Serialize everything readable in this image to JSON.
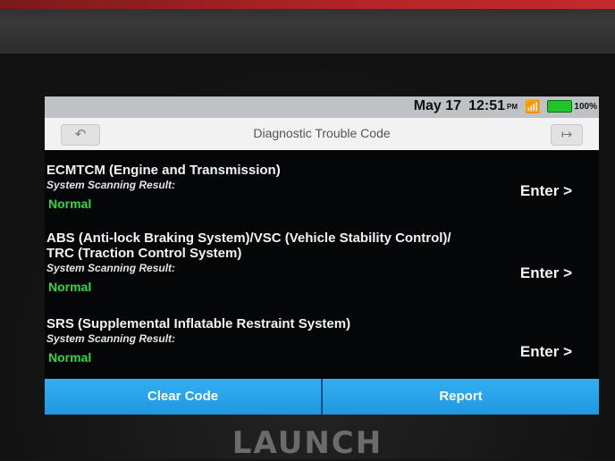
{
  "status": {
    "date": "May 17",
    "time": "12:51",
    "ampm": "PM",
    "battery": "100%"
  },
  "header": {
    "title": "Diagnostic Trouble Code",
    "back_icon": "back-arrow-icon",
    "exit_icon": "exit-icon"
  },
  "systems": [
    {
      "name": "ECMTCM (Engine and Transmission)",
      "result_label": "System Scanning Result:",
      "result": "Normal",
      "action": "Enter >"
    },
    {
      "name": "ABS (Anti-lock Braking System)/VSC (Vehicle Stability Control)/ TRC (Traction Control System)",
      "result_label": "System Scanning Result:",
      "result": "Normal",
      "action": "Enter >"
    },
    {
      "name": "SRS (Supplemental Inflatable Restraint System)",
      "result_label": "System Scanning Result:",
      "result": "Normal",
      "action": "Enter >"
    }
  ],
  "footer": {
    "clear_label": "Clear Code",
    "report_label": "Report"
  },
  "device": {
    "brand": "LAUNCH"
  },
  "colors": {
    "status_normal": "#35d545",
    "button_blue": "#2aa6ea"
  }
}
